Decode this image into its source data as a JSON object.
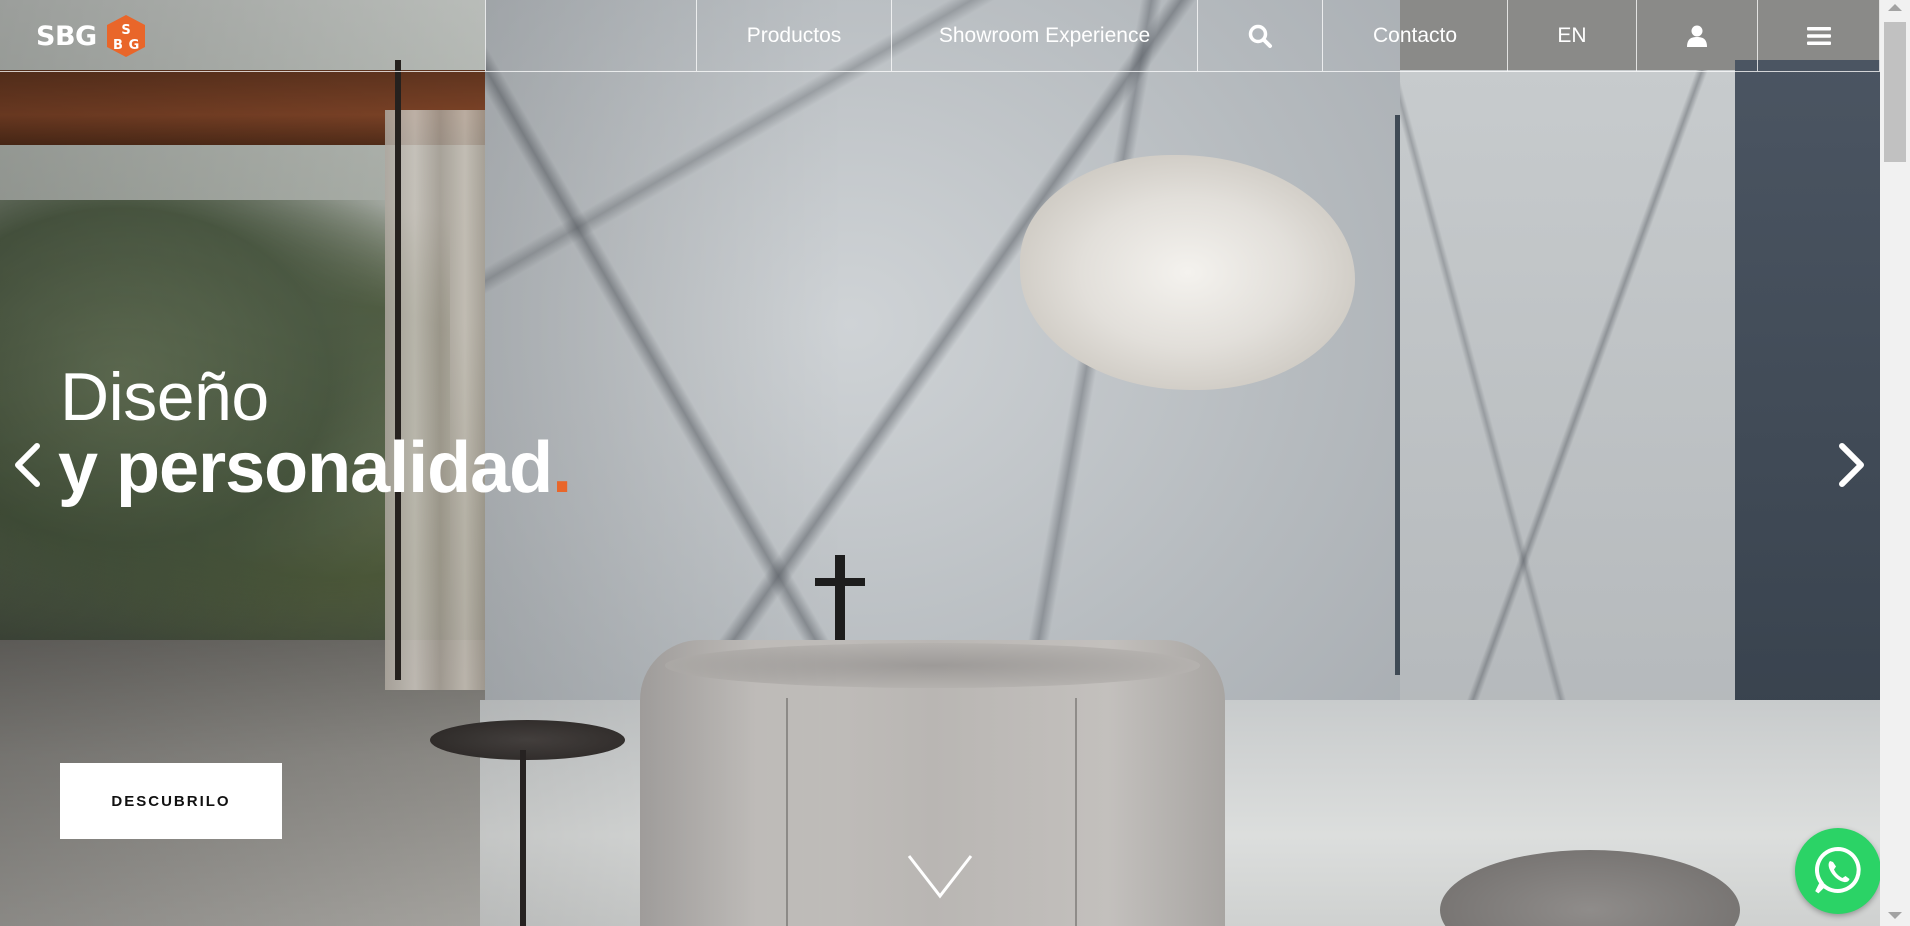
{
  "brand": {
    "name": "SBG",
    "accent_color": "#e9662a"
  },
  "nav": {
    "products_label": "Productos",
    "showroom_label": "Showroom Experience",
    "search_icon": "search-icon",
    "contact_label": "Contacto",
    "language_label": "EN",
    "user_icon": "user-icon",
    "menu_icon": "hamburger-menu-icon"
  },
  "hero": {
    "headline_line1": "Diseño",
    "headline_line2": "y personalidad",
    "headline_dot": ".",
    "cta_label": "DESCUBRILO",
    "prev_icon": "chevron-left-icon",
    "next_icon": "chevron-right-icon",
    "scroll_icon": "chevron-down-icon"
  },
  "floating": {
    "whatsapp_icon": "whatsapp-icon",
    "whatsapp_color": "#2bd366"
  }
}
